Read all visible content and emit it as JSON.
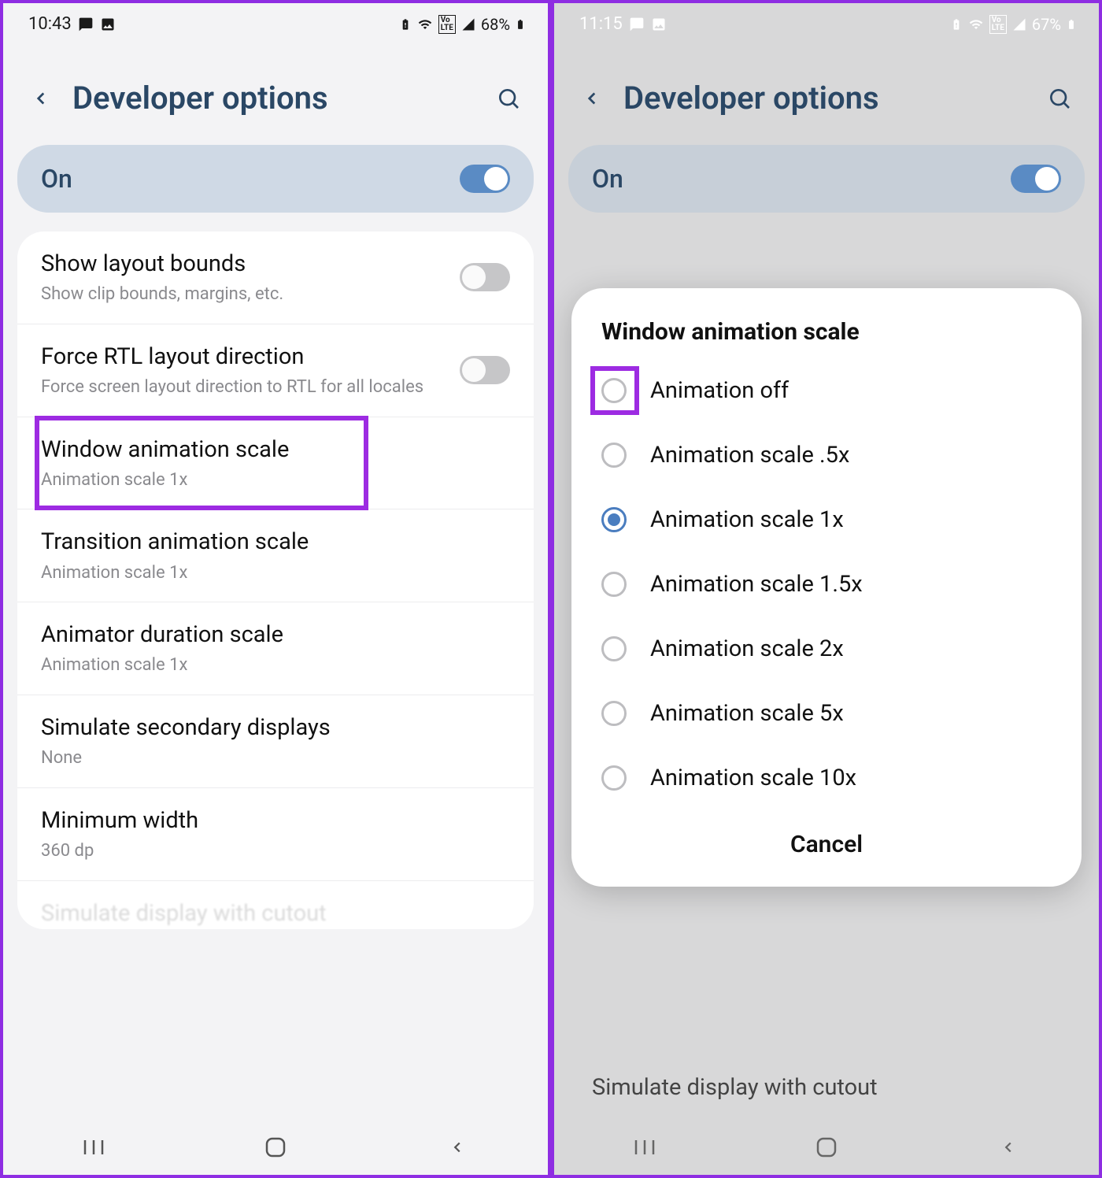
{
  "left": {
    "status": {
      "time": "10:43",
      "battery": "68%",
      "lte": "LTE"
    },
    "header": {
      "title": "Developer options"
    },
    "on_row": {
      "label": "On"
    },
    "rows": [
      {
        "title": "Show layout bounds",
        "sub": "Show clip bounds, margins, etc.",
        "toggle": "off"
      },
      {
        "title": "Force RTL layout direction",
        "sub": "Force screen layout direction to RTL for all locales",
        "toggle": "off"
      },
      {
        "title": "Window animation scale",
        "sub": "Animation scale 1x",
        "highlight": true
      },
      {
        "title": "Transition animation scale",
        "sub": "Animation scale 1x"
      },
      {
        "title": "Animator duration scale",
        "sub": "Animation scale 1x"
      },
      {
        "title": "Simulate secondary displays",
        "sub": "None"
      },
      {
        "title": "Minimum width",
        "sub": "360 dp"
      }
    ]
  },
  "right": {
    "status": {
      "time": "11:15",
      "battery": "67%",
      "lte": "LTE"
    },
    "header": {
      "title": "Developer options"
    },
    "on_row": {
      "label": "On"
    },
    "bg_row": "Simulate display with cutout",
    "dialog": {
      "title": "Window animation scale",
      "options": [
        {
          "label": "Animation off",
          "selected": false,
          "highlight": true
        },
        {
          "label": "Animation scale .5x",
          "selected": false
        },
        {
          "label": "Animation scale 1x",
          "selected": true
        },
        {
          "label": "Animation scale 1.5x",
          "selected": false
        },
        {
          "label": "Animation scale 2x",
          "selected": false
        },
        {
          "label": "Animation scale 5x",
          "selected": false
        },
        {
          "label": "Animation scale 10x",
          "selected": false
        }
      ],
      "cancel": "Cancel"
    }
  }
}
